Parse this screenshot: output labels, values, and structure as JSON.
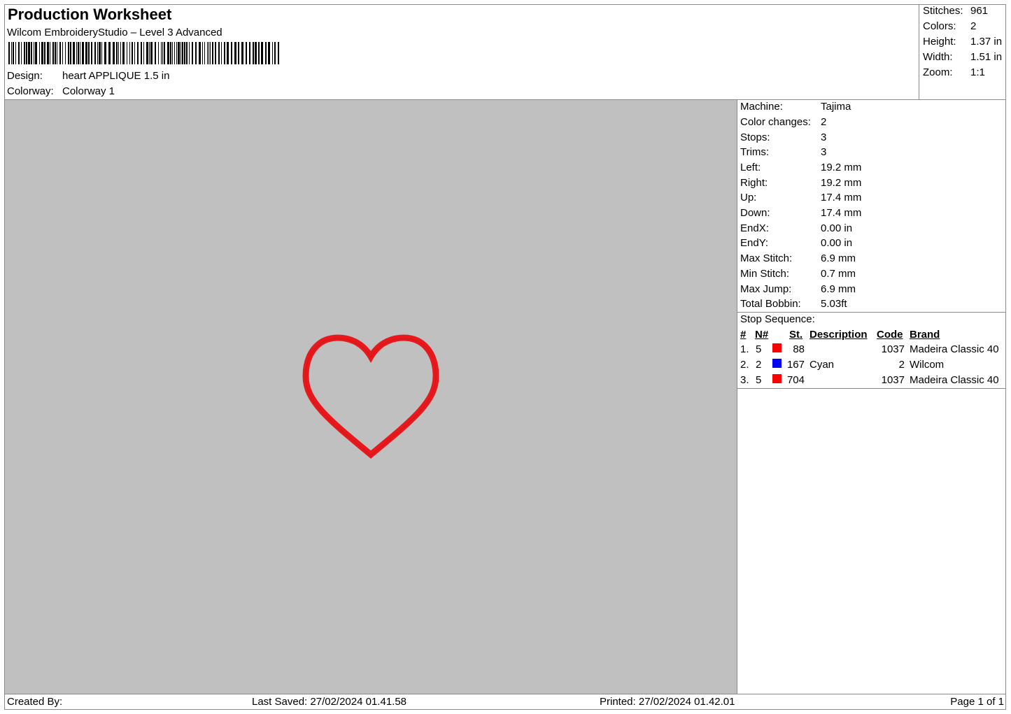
{
  "header": {
    "title": "Production Worksheet",
    "software": "Wilcom EmbroideryStudio – Level 3 Advanced",
    "design_label": "Design:",
    "design_value": "heart APPLIQUE 1.5 in",
    "colorway_label": "Colorway:",
    "colorway_value": "Colorway 1"
  },
  "summary": [
    {
      "label": "Stitches:",
      "value": "961"
    },
    {
      "label": "Colors:",
      "value": "2"
    },
    {
      "label": "Height:",
      "value": "1.37 in"
    },
    {
      "label": "Width:",
      "value": "1.51 in"
    },
    {
      "label": "Zoom:",
      "value": "1:1"
    }
  ],
  "machine_info": [
    {
      "label": "Machine:",
      "value": "Tajima"
    },
    {
      "label": "Color changes:",
      "value": "2"
    },
    {
      "label": "Stops:",
      "value": "3"
    },
    {
      "label": "Trims:",
      "value": "3"
    },
    {
      "label": "Left:",
      "value": "19.2 mm"
    },
    {
      "label": "Right:",
      "value": "19.2 mm"
    },
    {
      "label": "Up:",
      "value": "17.4 mm"
    },
    {
      "label": "Down:",
      "value": "17.4 mm"
    },
    {
      "label": "EndX:",
      "value": "0.00 in"
    },
    {
      "label": "EndY:",
      "value": "0.00 in"
    },
    {
      "label": "Max Stitch:",
      "value": "6.9 mm"
    },
    {
      "label": "Min Stitch:",
      "value": "0.7 mm"
    },
    {
      "label": "Max Jump:",
      "value": "6.9 mm"
    },
    {
      "label": "Total Bobbin:",
      "value": "5.03ft"
    }
  ],
  "stop_sequence": {
    "title": "Stop Sequence:",
    "columns": [
      "#",
      "N#",
      "St.",
      "Description",
      "Code",
      "Brand"
    ],
    "rows": [
      {
        "num": "1.",
        "n": "5",
        "color": "#ff0000",
        "st": "88",
        "description": "",
        "code": "1037",
        "brand": "Madeira Classic 40"
      },
      {
        "num": "2.",
        "n": "2",
        "color": "#0000ff",
        "st": "167",
        "description": "Cyan",
        "code": "2",
        "brand": "Wilcom"
      },
      {
        "num": "3.",
        "n": "5",
        "color": "#ff0000",
        "st": "704",
        "description": "",
        "code": "1037",
        "brand": "Madeira Classic 40"
      }
    ]
  },
  "design_preview": {
    "background": "#c0c0c0",
    "stitch_color": "#e8191c"
  },
  "footer": {
    "created_by": "Created By:",
    "last_saved": "Last Saved: 27/02/2024 01.41.58",
    "printed": "Printed: 27/02/2024 01.42.01",
    "page": "Page 1 of 1"
  }
}
